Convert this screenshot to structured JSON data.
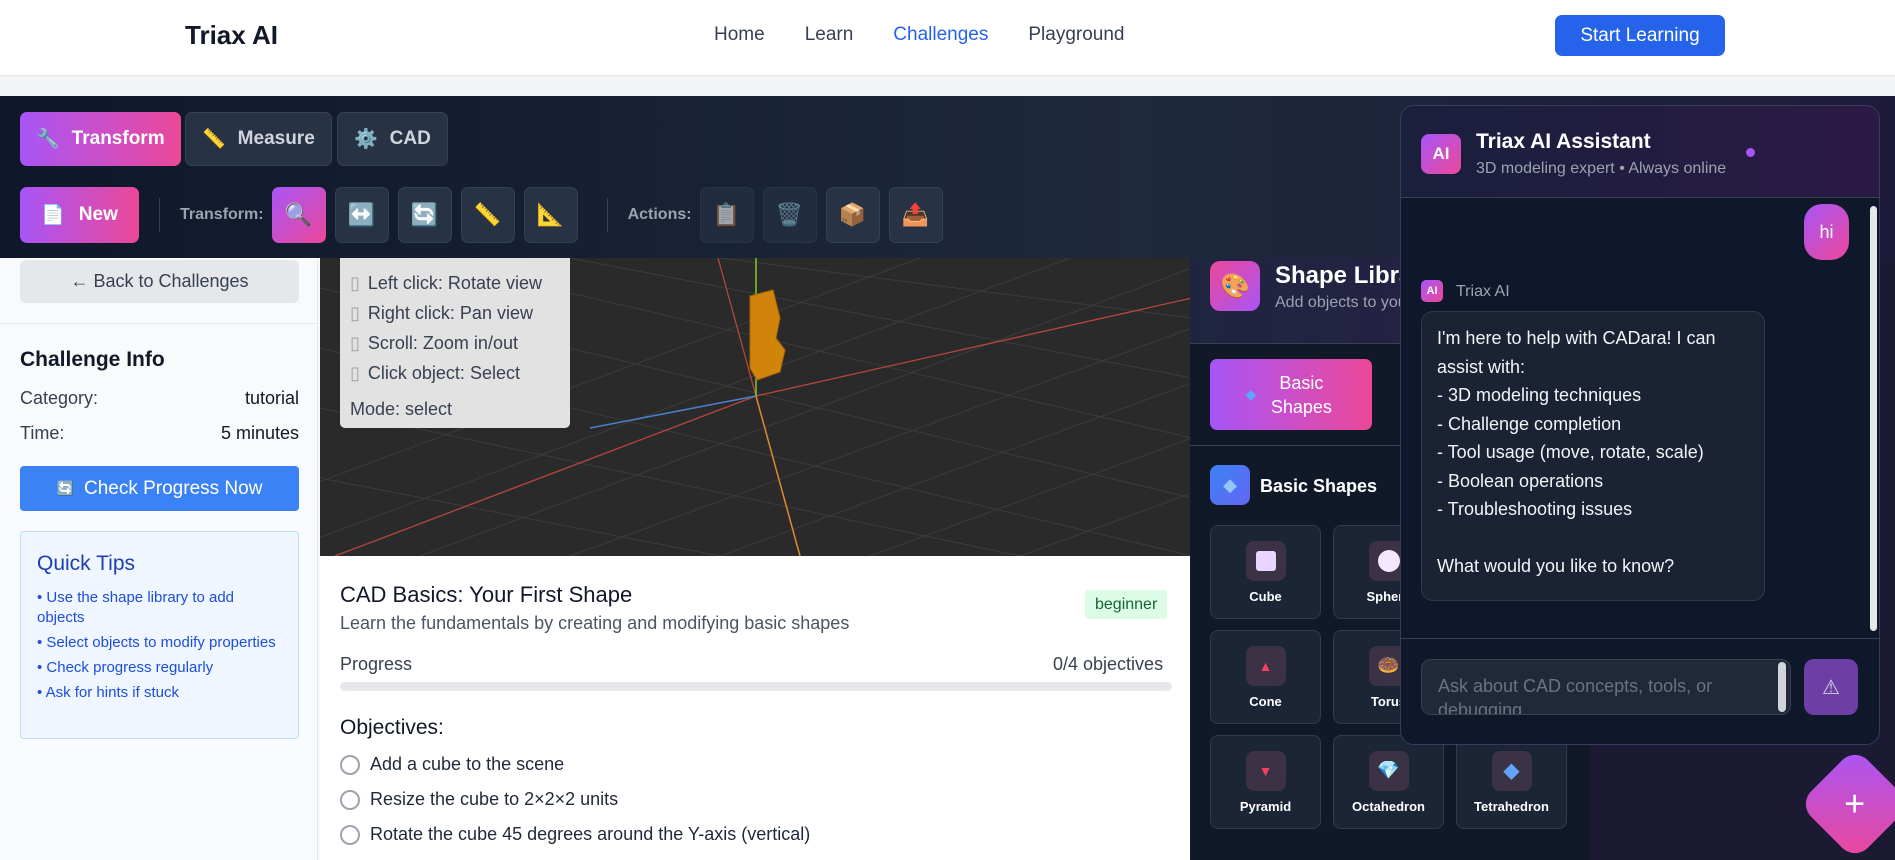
{
  "header": {
    "brand": "Triax AI",
    "nav": [
      "Home",
      "Learn",
      "Challenges",
      "Playground"
    ],
    "active_nav": "Challenges",
    "cta": "Start Learning"
  },
  "toolbar": {
    "modes": [
      {
        "icon": "🔧",
        "label": "Transform"
      },
      {
        "icon": "📏",
        "label": "Measure"
      },
      {
        "icon": "⚙️",
        "label": "CAD"
      }
    ],
    "new_label": "New",
    "new_icon": "📄",
    "transform_label": "Transform:",
    "transform_tools": [
      "🔍",
      "↔️",
      "🔄",
      "📏",
      "📐"
    ],
    "actions_label": "Actions:",
    "action_tools": [
      "📋",
      "🗑️",
      "📦",
      "📤"
    ]
  },
  "left": {
    "back": "← Back to Challenges",
    "info_title": "Challenge Info",
    "category_label": "Category:",
    "category_value": "tutorial",
    "time_label": "Time:",
    "time_value": "5 minutes",
    "check_icon": "🔄",
    "check_label": "Check Progress Now",
    "tips_title": "Quick Tips",
    "tips": [
      "• Use the shape library to add objects",
      "• Select objects to modify properties",
      "• Check progress regularly",
      "• Ask for hints if stuck"
    ]
  },
  "viewport": {
    "help": [
      "Left click: Rotate view",
      "Right click: Pan view",
      "Scroll: Zoom in/out",
      "Click object: Select"
    ],
    "mode": "Mode: select"
  },
  "challenge": {
    "title": "CAD Basics: Your First Shape",
    "subtitle": "Learn the fundamentals by creating and modifying basic shapes",
    "level": "beginner",
    "progress_label": "Progress",
    "progress_value": "0/4 objectives",
    "progress_fraction": 0,
    "objectives_title": "Objectives:",
    "objectives": [
      "Add a cube to the scene",
      "Resize the cube to 2×2×2 units",
      "Rotate the cube 45 degrees around the Y-axis (vertical)"
    ]
  },
  "shape_library": {
    "title": "Shape Library",
    "subtitle": "Add objects to your scene",
    "tab_label": "Basic Shapes",
    "section_title": "Basic Shapes",
    "shapes": [
      {
        "name": "Cube",
        "icon": "⬜"
      },
      {
        "name": "Sphere",
        "icon": "⚪"
      },
      {
        "name": "Cone",
        "icon": "🔺"
      },
      {
        "name": "Torus",
        "icon": "🍩"
      },
      {
        "name": "Pyramid",
        "icon": "🔻"
      },
      {
        "name": "Octahedron",
        "icon": "💎"
      },
      {
        "name": "Tetrahedron",
        "icon": "🔷"
      }
    ]
  },
  "chat": {
    "badge": "AI",
    "title": "Triax AI Assistant",
    "subtitle": "3D modeling expert • Always online",
    "user_message": "hi",
    "ai_name": "Triax AI",
    "ai_message": "I'm here to help with CADara! I can assist with:\n- 3D modeling techniques\n- Challenge completion\n- Tool usage (move, rotate, scale)\n- Boolean operations\n- Troubleshooting issues\n\nWhat would you like to know?",
    "input_placeholder": "Ask about CAD concepts, tools, or debugging..."
  },
  "colors": {
    "accent": "#a855f7",
    "accent2": "#ec4899",
    "primary": "#2563eb"
  }
}
